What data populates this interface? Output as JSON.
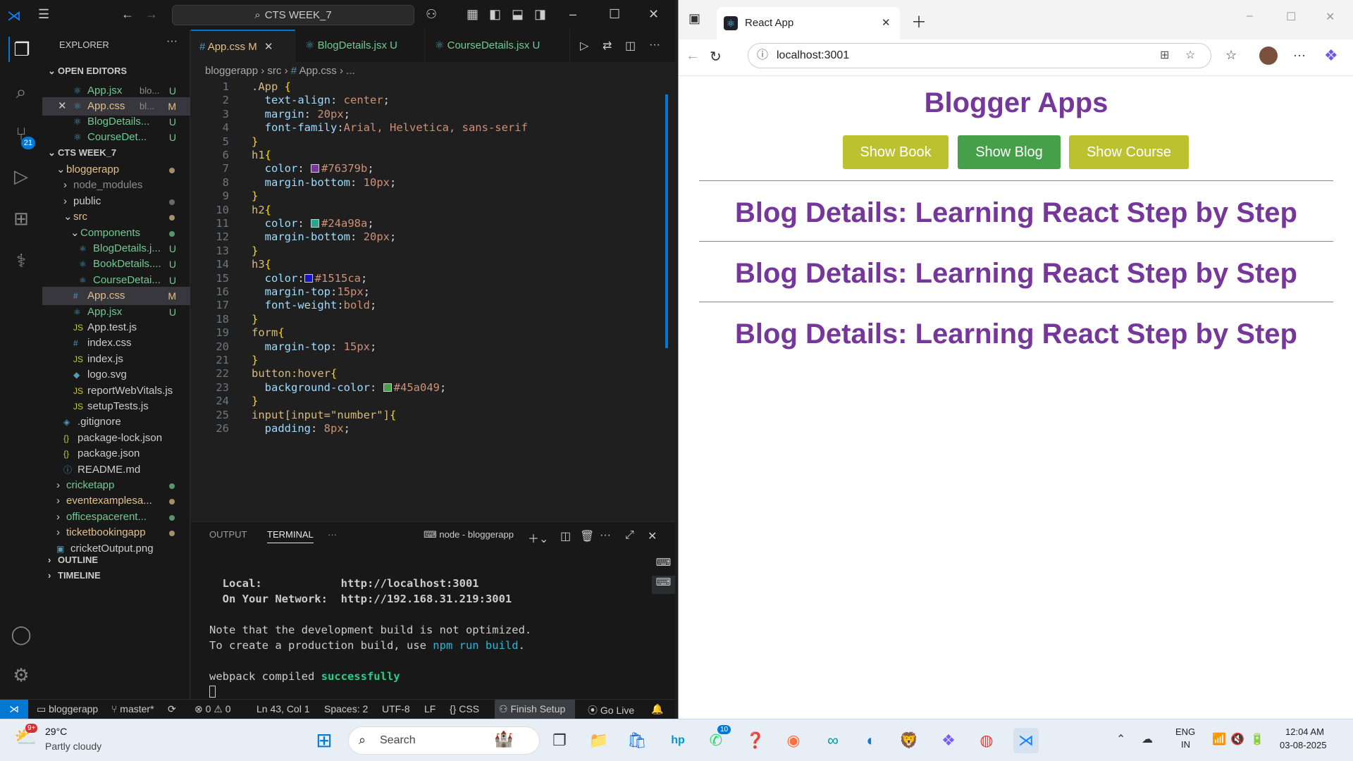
{
  "vscode": {
    "title": "CTS WEEK_7",
    "explorer_title": "EXPLORER",
    "open_editors_label": "OPEN EDITORS",
    "open_editors": [
      {
        "name": "App.jsx",
        "dir": "blo...",
        "status": "U",
        "color": "#73c991"
      },
      {
        "name": "App.css",
        "dir": "bl...",
        "status": "M",
        "color": "#e2c08d"
      },
      {
        "name": "BlogDetails...",
        "dir": "",
        "status": "U",
        "color": "#73c991"
      },
      {
        "name": "CourseDet...",
        "dir": "",
        "status": "U",
        "color": "#73c991"
      }
    ],
    "workspace_label": "CTS WEEK_7",
    "tree": [
      {
        "name": "bloggerapp",
        "color": "#e2c08d"
      },
      {
        "name": "node_modules",
        "color": "#8c8c8c"
      },
      {
        "name": "public",
        "color": "#ccc"
      },
      {
        "name": "src",
        "color": "#e2c08d"
      },
      {
        "name": "Components",
        "color": "#73c991"
      },
      {
        "name": "BlogDetails.j...",
        "status": "U",
        "color": "#73c991"
      },
      {
        "name": "BookDetails....",
        "status": "U",
        "color": "#73c991"
      },
      {
        "name": "CourseDetai...",
        "status": "U",
        "color": "#73c991"
      },
      {
        "name": "App.css",
        "status": "M",
        "color": "#e2c08d"
      },
      {
        "name": "App.jsx",
        "status": "U",
        "color": "#73c991"
      },
      {
        "name": "App.test.js",
        "color": "#ccc"
      },
      {
        "name": "index.css",
        "color": "#ccc"
      },
      {
        "name": "index.js",
        "color": "#ccc"
      },
      {
        "name": "logo.svg",
        "color": "#ccc"
      },
      {
        "name": "reportWebVitals.js",
        "color": "#ccc"
      },
      {
        "name": "setupTests.js",
        "color": "#ccc"
      },
      {
        "name": ".gitignore",
        "color": "#ccc"
      },
      {
        "name": "package-lock.json",
        "color": "#ccc"
      },
      {
        "name": "package.json",
        "color": "#ccc"
      },
      {
        "name": "README.md",
        "color": "#ccc"
      },
      {
        "name": "cricketapp",
        "color": "#73c991"
      },
      {
        "name": "eventexamplesa...",
        "color": "#e2c08d"
      },
      {
        "name": "officespacerent...",
        "color": "#73c991"
      },
      {
        "name": "ticketbookingapp",
        "color": "#e2c08d"
      },
      {
        "name": "cricketOutput.png",
        "color": "#ccc"
      }
    ],
    "outline_label": "OUTLINE",
    "timeline_label": "TIMELINE",
    "scm_badge": "21",
    "tabs": [
      {
        "name": "App.css",
        "status": "M"
      },
      {
        "name": "BlogDetails.jsx",
        "status": "U"
      },
      {
        "name": "CourseDetails.jsx",
        "status": "U"
      }
    ],
    "breadcrumb": [
      "bloggerapp",
      "src",
      "App.css",
      "..."
    ],
    "code": [
      ".App {",
      "  text-align: center;",
      "  margin: 20px;",
      "  font-family:Arial, Helvetica, sans-serif",
      "}",
      "h1{",
      "  color: #76379b;",
      "  margin-bottom: 10px;",
      "}",
      "h2{",
      "  color: #24a98a;",
      "  margin-bottom: 20px;",
      "}",
      "h3{",
      "  color:#1515ca;",
      "  margin-top:15px;",
      "  font-weight:bold;",
      "}",
      "form{",
      "  margin-top: 15px;",
      "}",
      "button:hover{",
      "  background-color: #45a049;",
      "}",
      "input[input=\"number\"]{",
      "  padding: 8px;"
    ],
    "panel_tabs": [
      "OUTPUT",
      "TERMINAL"
    ],
    "terminal_name": "node - bloggerapp",
    "terminal_lines": [
      "  Local:            http://localhost:3001",
      "  On Your Network:  http://192.168.31.219:3001",
      "",
      "Note that the development build is not optimized.",
      "To create a production build, use npm run build.",
      "",
      "webpack compiled successfully"
    ],
    "status": {
      "folder": "bloggerapp",
      "branch": "master*",
      "problems": "0",
      "warnings": "0",
      "position": "Ln 43, Col 1",
      "spaces": "Spaces: 2",
      "encoding": "UTF-8",
      "eol": "LF",
      "language": "CSS",
      "finish_setup": "Finish Setup",
      "go_live": "Go Live"
    }
  },
  "browser": {
    "tab_title": "React App",
    "url": "localhost:3001",
    "heading": "Blogger Apps",
    "buttons": [
      "Show Book",
      "Show Blog",
      "Show Course"
    ],
    "button_colors": [
      "#bcc22f",
      "#45a049",
      "#bcc22f"
    ],
    "blog_headings": [
      "Blog Details: Learning React Step by Step",
      "Blog Details: Learning React Step by Step",
      "Blog Details: Learning React Step by Step"
    ]
  },
  "taskbar": {
    "weather_temp": "29°C",
    "weather_desc": "Partly cloudy",
    "weather_badge": "9+",
    "search_placeholder": "Search",
    "whatsapp_badge": "10",
    "lang": "ENG",
    "region": "IN",
    "time": "12:04 AM",
    "date": "03-08-2025"
  },
  "colors": {
    "h1": "#76379b",
    "h2": "#24a98a",
    "h3": "#1515ca",
    "hover": "#45a049",
    "vscode_accent": "#0078d4"
  }
}
